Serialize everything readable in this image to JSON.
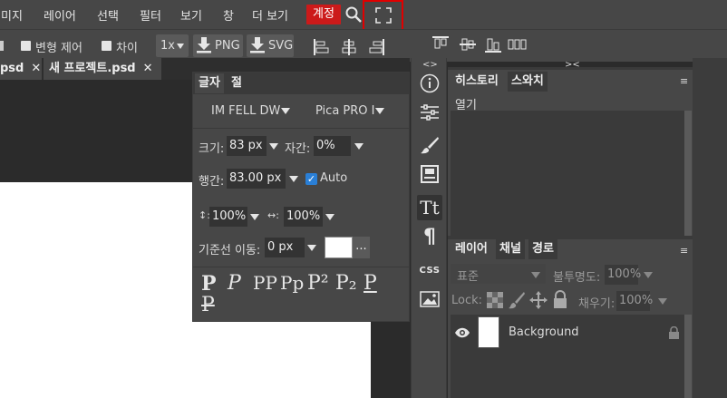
{
  "menubar": {
    "items": [
      "미지",
      "레이어",
      "선택",
      "필터",
      "보기",
      "창",
      "더 보기"
    ],
    "account": "계정"
  },
  "options": {
    "transform_controls": "변형 제어",
    "distances": "차이",
    "scale": "1x",
    "png": "PNG",
    "svg": "SVG"
  },
  "tabs": [
    {
      "label": "psd"
    },
    {
      "label": "새 프로젝트.psd"
    }
  ],
  "character_panel": {
    "tabs": [
      "글자",
      "절"
    ],
    "font_family": "IM FELL DW",
    "font_style": "Pica PRO I",
    "size_label": "크기:",
    "size_value": "83 px",
    "tracking_label": "자간:",
    "tracking_value": "0%",
    "leading_label": "행간:",
    "leading_value": "83.00 px",
    "auto_label": "Auto",
    "vscale_glyph": "↕:",
    "vscale_value": "100%",
    "hscale_glyph": "↔:",
    "hscale_value": "100%",
    "baseline_label": "기준선 이동:",
    "baseline_value": "0 px",
    "more": "...",
    "style_glyphs": [
      "P",
      "P",
      "PP",
      "Pp",
      "P²",
      "P₂",
      "P",
      "P"
    ],
    "text_color": "#ffffff"
  },
  "toolstrip": {
    "collapse_left": "<>",
    "collapse_right": "><",
    "icons": [
      "info-icon",
      "adjustments-icon",
      "brush-icon",
      "properties-icon",
      "character-icon",
      "paragraph-icon",
      "css-icon",
      "image-icon"
    ],
    "css_label": "CSS",
    "text_tool_label": "Tt",
    "paragraph_label": "¶"
  },
  "history_panel": {
    "tabs": [
      "히스토리",
      "스와치"
    ],
    "items": [
      "열기"
    ],
    "menu": "≡"
  },
  "layers_panel": {
    "tabs": [
      "레이어",
      "채널",
      "경로"
    ],
    "menu": "≡",
    "blend_mode": "표준",
    "opacity_label": "불투명도:",
    "opacity_value": "100%",
    "lock_label": "Lock:",
    "fill_label": "채우기:",
    "fill_value": "100%",
    "layers": [
      {
        "name": "Background"
      }
    ]
  },
  "colors": {
    "account_red": "#cc1a1a",
    "highlight": "#e00000",
    "checkbox_blue": "#2a7fd6"
  }
}
